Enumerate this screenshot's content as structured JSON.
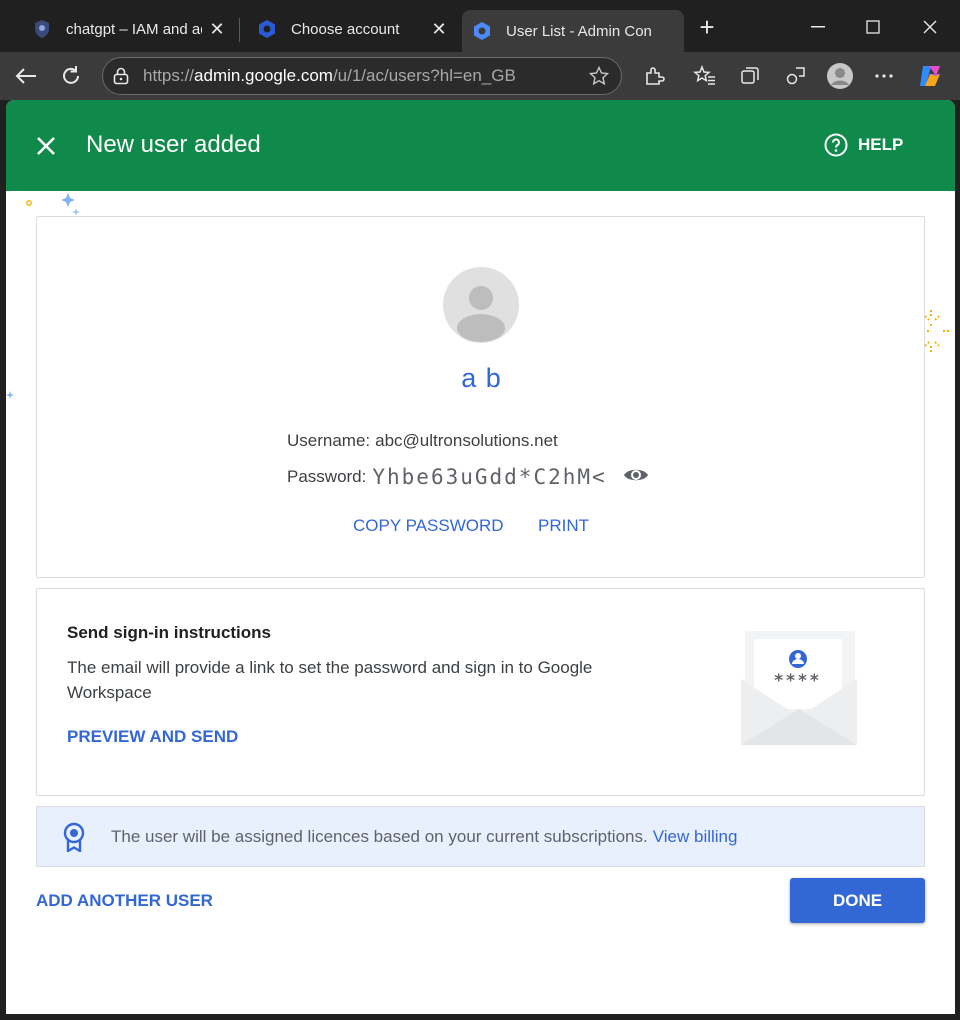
{
  "browser": {
    "tabs": [
      {
        "title": "chatgpt – IAM and adr",
        "active": false,
        "icon": "shield-icon"
      },
      {
        "title": "Choose account",
        "active": false,
        "icon": "google-cloud-icon"
      },
      {
        "title": "User List - Admin Con",
        "active": true,
        "icon": "google-cloud-icon"
      }
    ],
    "url_prefix": "https://",
    "url_host": "admin.google.com",
    "url_path": "/u/1/ac/users?hl=en_GB"
  },
  "banner": {
    "title": "New user added",
    "help_label": "HELP",
    "color": "#108a4a"
  },
  "user": {
    "display_name": "a b",
    "username_label": "Username:",
    "username": "abc@ultronsolutions.net",
    "password_label": "Password:",
    "password": "Yhbe63uGdd*C2hM<"
  },
  "actions": {
    "copy_password": "COPY PASSWORD",
    "print": "PRINT",
    "add_another": "ADD ANOTHER USER",
    "done": "DONE"
  },
  "signin": {
    "title": "Send sign-in instructions",
    "description": "The email will provide a link to set the password and sign in to Google Workspace",
    "preview_send": "PREVIEW AND SEND",
    "envelope_mask": "****"
  },
  "licence": {
    "message": "The user will be assigned licences based on your current subscriptions.",
    "link": "View billing"
  },
  "colors": {
    "accent": "#3367d6",
    "info_bg": "#e8f0fe"
  }
}
